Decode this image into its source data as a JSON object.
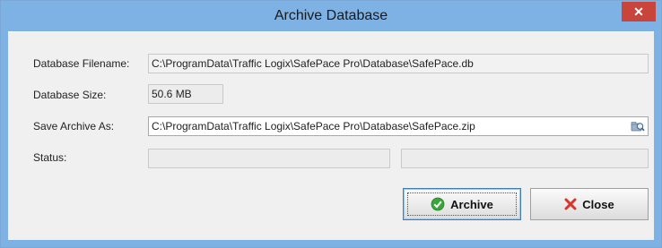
{
  "window": {
    "title": "Archive Database",
    "close_glyph": "✕"
  },
  "form": {
    "filename_label": "Database Filename:",
    "filename_value": "C:\\ProgramData\\Traffic Logix\\SafePace Pro\\Database\\SafePace.db",
    "size_label": "Database Size:",
    "size_value": "50.6 MB",
    "save_as_label": "Save Archive As:",
    "save_as_value": "C:\\ProgramData\\Traffic Logix\\SafePace Pro\\Database\\SafePace.zip",
    "status_label": "Status:",
    "status_text": "",
    "progress": 0
  },
  "buttons": {
    "archive_label": "Archive",
    "close_label": "Close"
  },
  "icons": {
    "browse": "folder-search-icon",
    "archive": "check-circle-icon",
    "close": "red-x-icon"
  },
  "colors": {
    "titlebar": "#7eb1e4",
    "close_button": "#c9443a",
    "check_green": "#3aa53a",
    "x_red": "#d9362b"
  }
}
